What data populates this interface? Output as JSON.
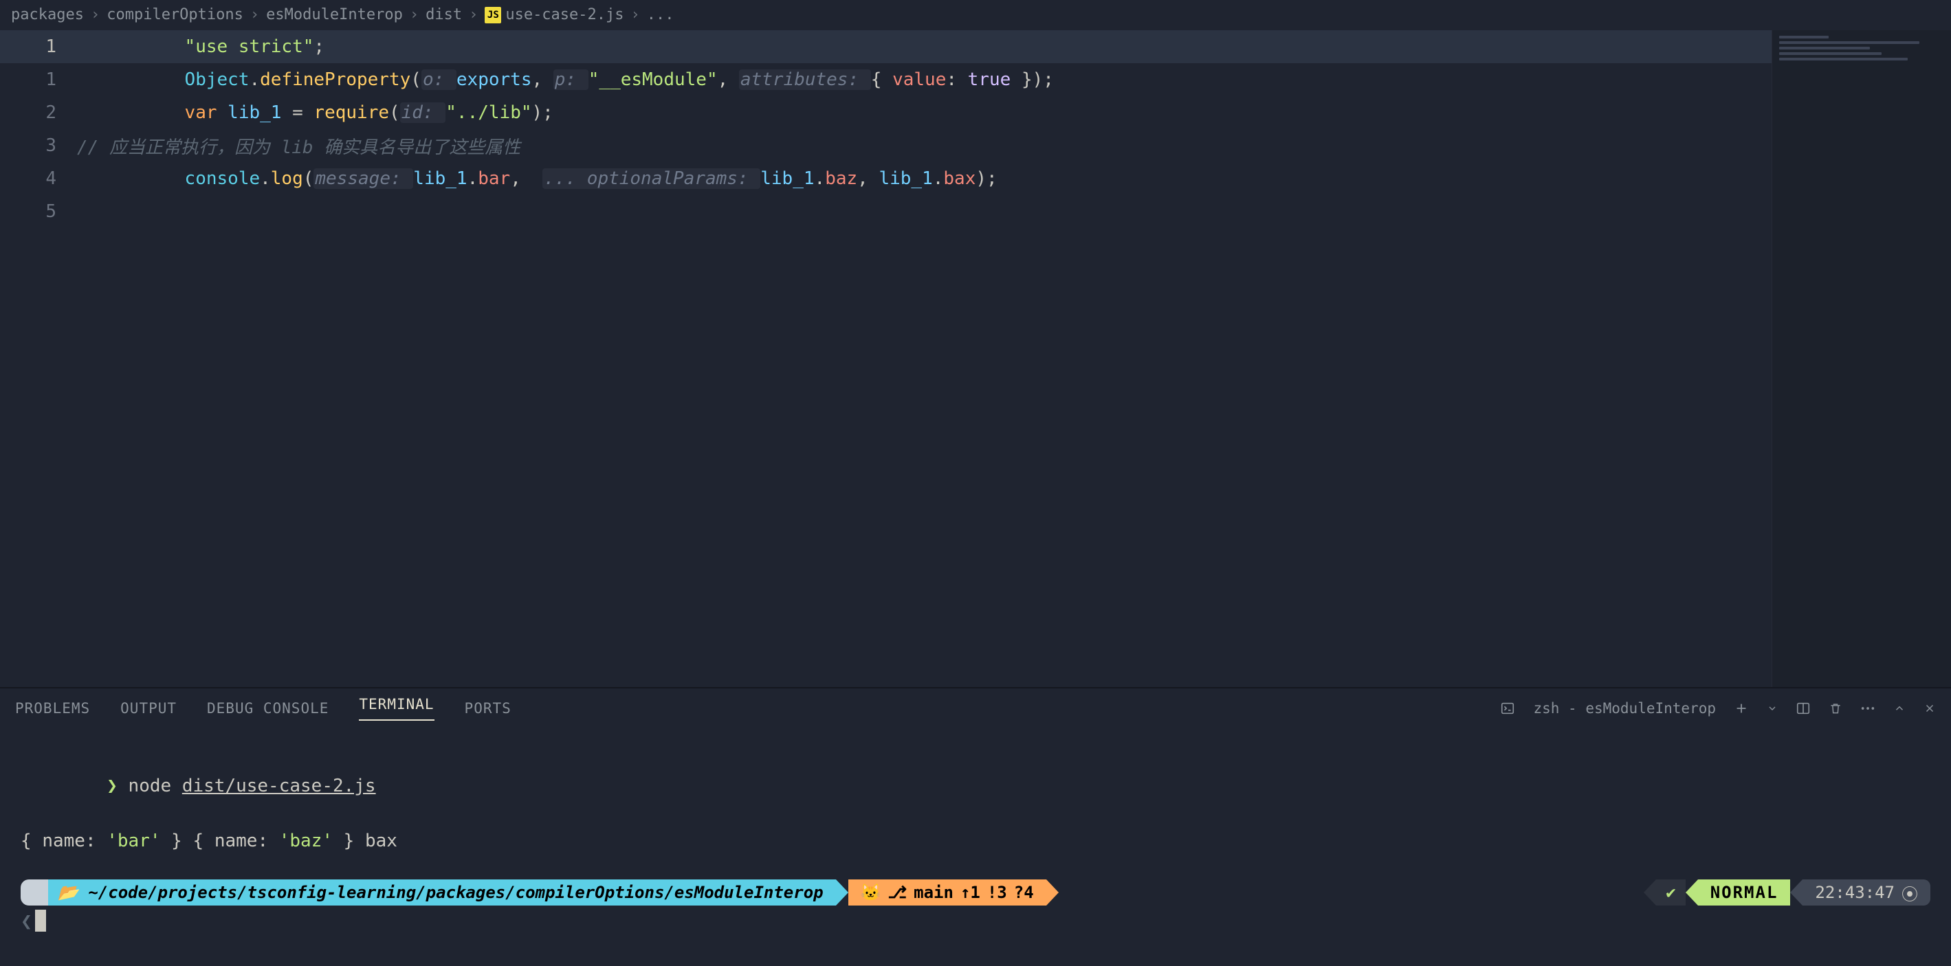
{
  "breadcrumbs": {
    "seg0": "packages",
    "seg1": "compilerOptions",
    "seg2": "esModuleInterop",
    "seg3": "dist",
    "seg4_icon": "JS",
    "seg4": "use-case-2.js",
    "seg5": "..."
  },
  "editor": {
    "gutter": {
      "n0": "1",
      "n1": "1",
      "n2": "2",
      "n3": "3",
      "n4": "4",
      "n5": "5"
    },
    "line0": {
      "str": "\"use strict\"",
      "semi": ";"
    },
    "line1": {
      "obj": "Object",
      "dot1": ".",
      "fn": "defineProperty",
      "open": "(",
      "hint_o": "o: ",
      "arg0": "exports",
      "c1": ", ",
      "hint_p": "p: ",
      "str": "\"__esModule\"",
      "c2": ", ",
      "hint_attr": "attributes: ",
      "brace_o": "{ ",
      "key": "value",
      "colon": ": ",
      "bool": "true",
      "brace_c": " });"
    },
    "line2": {
      "kw": "var",
      "sp": " ",
      "name": "lib_1",
      "eq": " = ",
      "fn": "require",
      "open": "(",
      "hint_id": "id: ",
      "str": "\"../lib\"",
      "close": ");"
    },
    "line3": {
      "cmt": "// 应当正常执行，因为 lib 确实具名导出了这些属性"
    },
    "line4": {
      "obj": "console",
      "dot": ".",
      "fn": "log",
      "open": "(",
      "hint_msg": "message: ",
      "a0a": "lib_1",
      "a0b": ".",
      "a0c": "bar",
      "c0": ",  ",
      "hint_opt": "... optionalParams: ",
      "a1a": "lib_1",
      "a1b": ".",
      "a1c": "baz",
      "c1": ", ",
      "a2a": "lib_1",
      "a2b": ".",
      "a2c": "bax",
      "close": ");"
    }
  },
  "panel": {
    "tabs": {
      "problems": "PROBLEMS",
      "output": "OUTPUT",
      "debug": "DEBUG CONSOLE",
      "terminal": "TERMINAL",
      "ports": "PORTS"
    },
    "right": {
      "shell": "zsh - esModuleInterop"
    }
  },
  "terminal": {
    "prompt_sym": "❯",
    "cmd": "node",
    "arg": "dist/use-case-2.js",
    "out_prefix0": "{ ",
    "out_key0": "name",
    "out_colon0": ": ",
    "out_val0": "'bar'",
    "out_suffix0": " } ",
    "out_prefix1": "{ ",
    "out_key1": "name",
    "out_colon1": ": ",
    "out_val1": "'baz'",
    "out_suffix1": " } ",
    "out_tail": "bax"
  },
  "statusline": {
    "apple": "",
    "folder_icon": "📁",
    "path": "~/code/projects/tsconfig-learning/packages/compilerOptions/esModuleInterop",
    "cat": "🐱",
    "branch_icon": "⎇",
    "branch": "main",
    "ahead": "↑1",
    "bang": "!3",
    "quest": "?4",
    "check": "✔",
    "mode": "NORMAL",
    "time": "22:43:47",
    "clock": "⦿"
  },
  "cursor": {
    "open": "❮"
  }
}
